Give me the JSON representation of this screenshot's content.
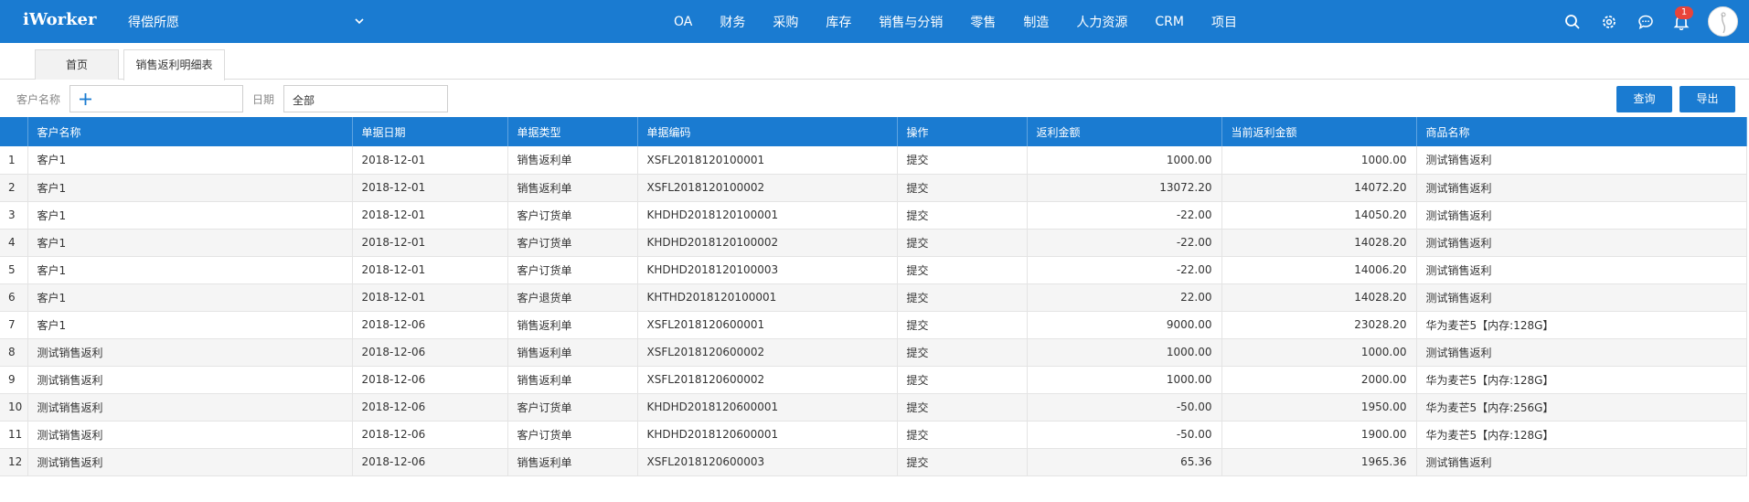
{
  "header": {
    "logo": "iWorker",
    "company": "得偿所愿",
    "nav": [
      "OA",
      "财务",
      "采购",
      "库存",
      "销售与分销",
      "零售",
      "制造",
      "人力资源",
      "CRM",
      "项目"
    ],
    "notification_count": "1",
    "icons": [
      "search-icon",
      "gear-icon",
      "chat-icon",
      "bell-icon"
    ],
    "accent_color": "#1a7bd1",
    "badge_color": "#e8443a"
  },
  "tabs": {
    "home": "首页",
    "active": "销售返利明细表"
  },
  "filter": {
    "customer_label": "客户名称",
    "date_label": "日期",
    "date_value": "全部",
    "query_button": "查询",
    "export_button": "导出"
  },
  "table": {
    "columns": [
      "客户名称",
      "单据日期",
      "单据类型",
      "单据编码",
      "操作",
      "返利金额",
      "当前返利金额",
      "商品名称"
    ],
    "rows": [
      {
        "idx": "1",
        "customer": "客户1",
        "date": "2018-12-01",
        "type": "销售返利单",
        "code": "XSFL2018120100001",
        "op": "提交",
        "amount": "1000.00",
        "current": "1000.00",
        "product": "测试销售返利"
      },
      {
        "idx": "2",
        "customer": "客户1",
        "date": "2018-12-01",
        "type": "销售返利单",
        "code": "XSFL2018120100002",
        "op": "提交",
        "amount": "13072.20",
        "current": "14072.20",
        "product": "测试销售返利"
      },
      {
        "idx": "3",
        "customer": "客户1",
        "date": "2018-12-01",
        "type": "客户订货单",
        "code": "KHDHD2018120100001",
        "op": "提交",
        "amount": "-22.00",
        "current": "14050.20",
        "product": "测试销售返利"
      },
      {
        "idx": "4",
        "customer": "客户1",
        "date": "2018-12-01",
        "type": "客户订货单",
        "code": "KHDHD2018120100002",
        "op": "提交",
        "amount": "-22.00",
        "current": "14028.20",
        "product": "测试销售返利"
      },
      {
        "idx": "5",
        "customer": "客户1",
        "date": "2018-12-01",
        "type": "客户订货单",
        "code": "KHDHD2018120100003",
        "op": "提交",
        "amount": "-22.00",
        "current": "14006.20",
        "product": "测试销售返利"
      },
      {
        "idx": "6",
        "customer": "客户1",
        "date": "2018-12-01",
        "type": "客户退货单",
        "code": "KHTHD2018120100001",
        "op": "提交",
        "amount": "22.00",
        "current": "14028.20",
        "product": "测试销售返利"
      },
      {
        "idx": "7",
        "customer": "客户1",
        "date": "2018-12-06",
        "type": "销售返利单",
        "code": "XSFL2018120600001",
        "op": "提交",
        "amount": "9000.00",
        "current": "23028.20",
        "product": "华为麦芒5【内存:128G】"
      },
      {
        "idx": "8",
        "customer": "测试销售返利",
        "date": "2018-12-06",
        "type": "销售返利单",
        "code": "XSFL2018120600002",
        "op": "提交",
        "amount": "1000.00",
        "current": "1000.00",
        "product": "测试销售返利"
      },
      {
        "idx": "9",
        "customer": "测试销售返利",
        "date": "2018-12-06",
        "type": "销售返利单",
        "code": "XSFL2018120600002",
        "op": "提交",
        "amount": "1000.00",
        "current": "2000.00",
        "product": "华为麦芒5【内存:128G】"
      },
      {
        "idx": "10",
        "customer": "测试销售返利",
        "date": "2018-12-06",
        "type": "客户订货单",
        "code": "KHDHD2018120600001",
        "op": "提交",
        "amount": "-50.00",
        "current": "1950.00",
        "product": "华为麦芒5【内存:256G】"
      },
      {
        "idx": "11",
        "customer": "测试销售返利",
        "date": "2018-12-06",
        "type": "客户订货单",
        "code": "KHDHD2018120600001",
        "op": "提交",
        "amount": "-50.00",
        "current": "1900.00",
        "product": "华为麦芒5【内存:128G】"
      },
      {
        "idx": "12",
        "customer": "测试销售返利",
        "date": "2018-12-06",
        "type": "销售返利单",
        "code": "XSFL2018120600003",
        "op": "提交",
        "amount": "65.36",
        "current": "1965.36",
        "product": "测试销售返利"
      }
    ]
  }
}
